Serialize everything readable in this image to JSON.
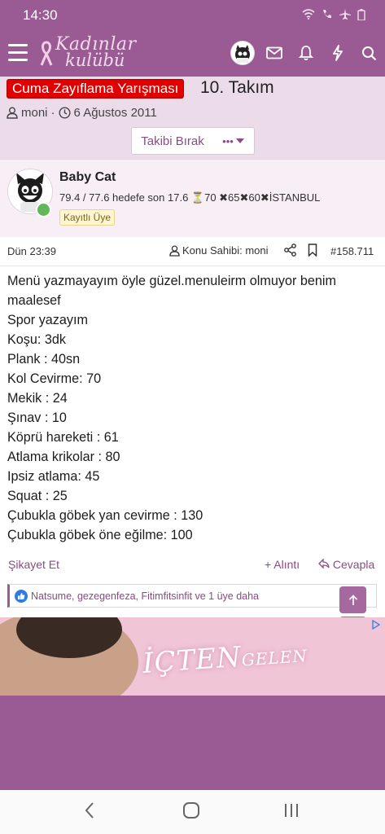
{
  "status": {
    "time": "14:30"
  },
  "header": {
    "logo_line1": "Kadınlar",
    "logo_line2": "kulübü"
  },
  "thread": {
    "prefix": "Cuma Zayıflama Yarışması",
    "title": "10. Takım",
    "author": "moni",
    "separator": "·",
    "date": "6 Ağustos 2011",
    "unfollow_label": "Takibi Bırak",
    "more_label": "•••"
  },
  "post": {
    "username": "Baby Cat",
    "user_stats": "79.4 / 77.6 hedefe son 17.6 ⏳70 ✖65✖60✖İSTANBUL",
    "user_badge": "Kayıtlı Üye",
    "time": "Dün 23:39",
    "owner_label": "Konu Sahibi: moni",
    "post_number": "#158.711",
    "lines": [
      "Menü yazmayayım öyle güzel.menuleirm olmuyor benim",
      "maalesef",
      "Spor yazayım",
      "Koşu: 3dk",
      "Plank : 40sn",
      "Kol Cevirme: 70",
      "Mekik : 24",
      "Şınav : 10",
      "Köprü hareketi : 61",
      "Atlama krikolar : 80",
      "Ipsiz atlama: 45",
      "Squat : 25",
      "Çubukla göbek yan cevirme : 130",
      "Çubukla göbek öne eğilme: 100"
    ],
    "report_label": "Şikayet Et",
    "quote_label": "+ Alıntı",
    "reply_label": "Cevapla",
    "likes_text": "Natsume, gezegenfeza, Fitimfitsinfit ve 1 üye daha"
  },
  "ad": {
    "text_main": "İÇTEN",
    "text_small": "GELEN"
  },
  "colors": {
    "brand": "#9a5a93",
    "prefix_red": "#e00000",
    "link": "#8a4a84"
  },
  "icons": [
    "menu-icon",
    "mail-icon",
    "bell-icon",
    "bolt-icon",
    "search-icon",
    "user-icon",
    "clock-icon",
    "share-icon",
    "bookmark-icon",
    "like-icon",
    "arrow-up-icon",
    "arrow-down-icon"
  ]
}
